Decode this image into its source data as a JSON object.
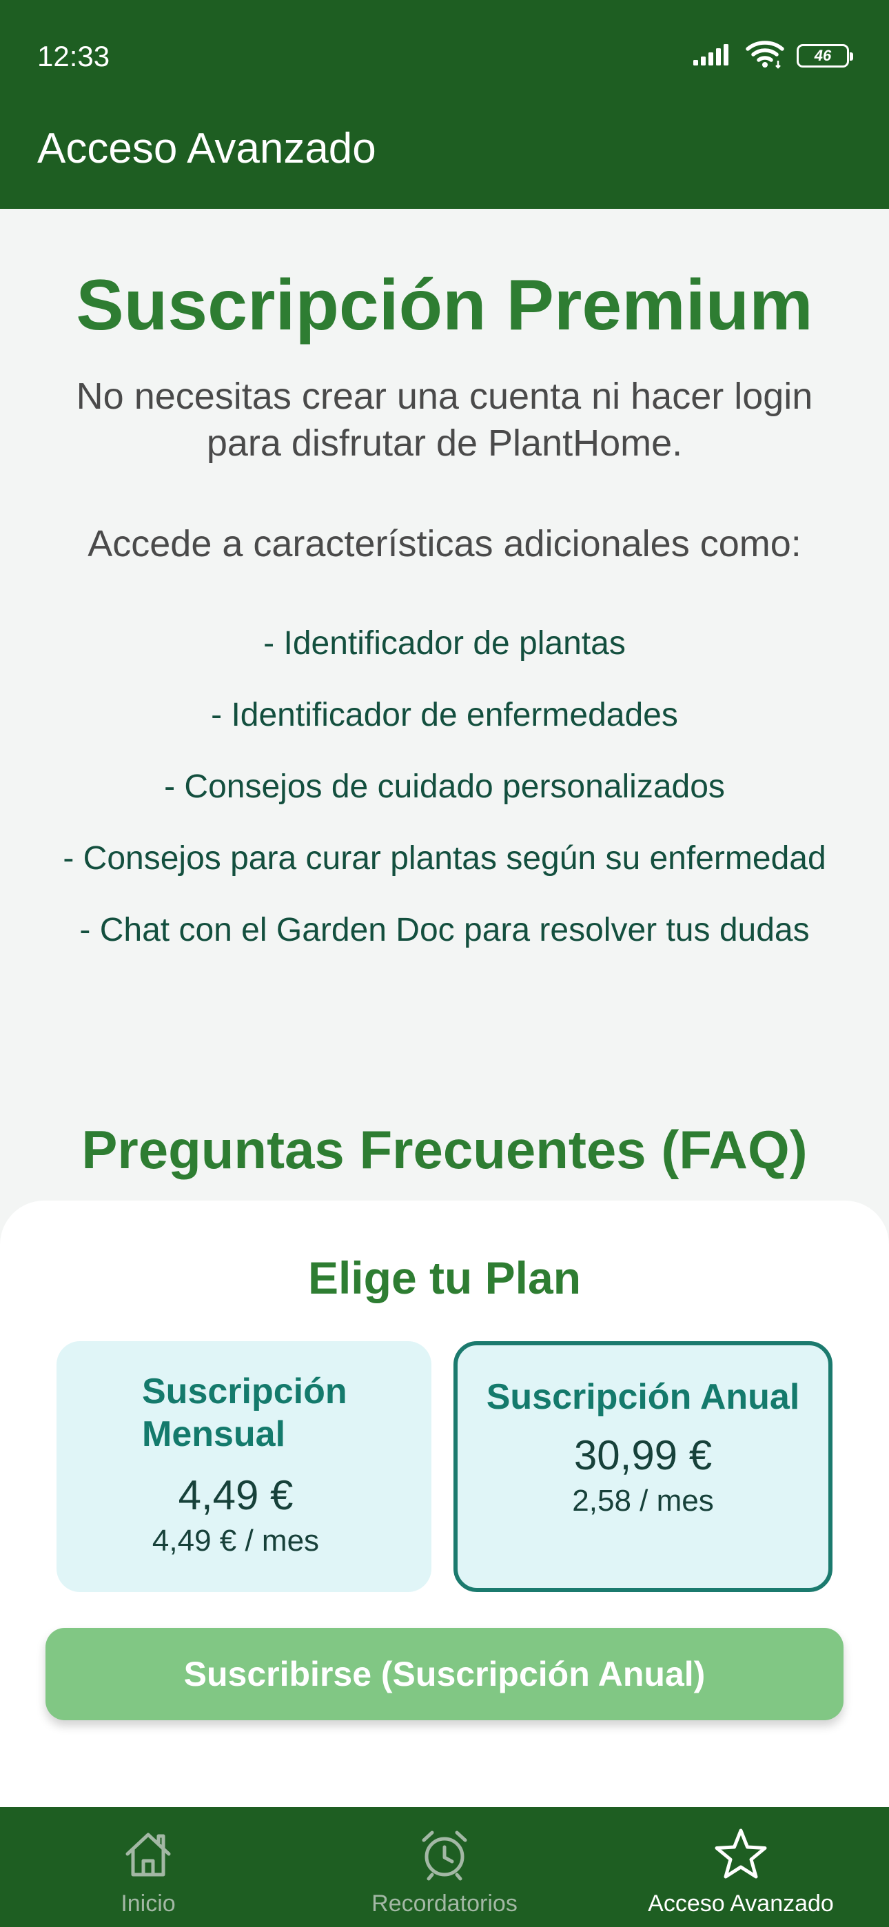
{
  "status_bar": {
    "time": "12:33",
    "battery": "46",
    "icons": [
      "signal-icon",
      "wifi-icon",
      "battery-icon"
    ]
  },
  "app_bar": {
    "title": "Acceso Avanzado"
  },
  "main": {
    "title": "Suscripción Premium",
    "intro": "No necesitas crear una cuenta ni hacer login para disfrutar de PlantHome.",
    "access_text": "Accede a características adicionales como:",
    "features": [
      "- Identificador de plantas",
      "- Identificador de enfermedades",
      "- Consejos de cuidado personalizados",
      "- Consejos para curar plantas según su enfermedad",
      "- Chat con el Garden Doc para resolver tus dudas"
    ],
    "faq_title": "Preguntas Frecuentes (FAQ)"
  },
  "plan_sheet": {
    "title": "Elige tu Plan",
    "plans": [
      {
        "name": "Suscripción Mensual",
        "price": "4,49 €",
        "per_month": "4,49 € / mes",
        "selected": false
      },
      {
        "name": "Suscripción Anual",
        "price": "30,99 €",
        "per_month": "2,58 / mes",
        "selected": true
      }
    ],
    "subscribe_label": "Suscribirse (Suscripción Anual)"
  },
  "bottom_nav": {
    "items": [
      {
        "label": "Inicio",
        "icon": "home-icon",
        "active": false
      },
      {
        "label": "Recordatorios",
        "icon": "alarm-clock-icon",
        "active": false
      },
      {
        "label": "Acceso Avanzado",
        "icon": "star-icon",
        "active": true
      }
    ]
  },
  "colors": {
    "primary_dark": "#1e5e22",
    "heading_green": "#2e7d32",
    "button_green": "#81c784",
    "card_background": "#e0f5f7",
    "card_selected_border": "#1b7a6e"
  }
}
